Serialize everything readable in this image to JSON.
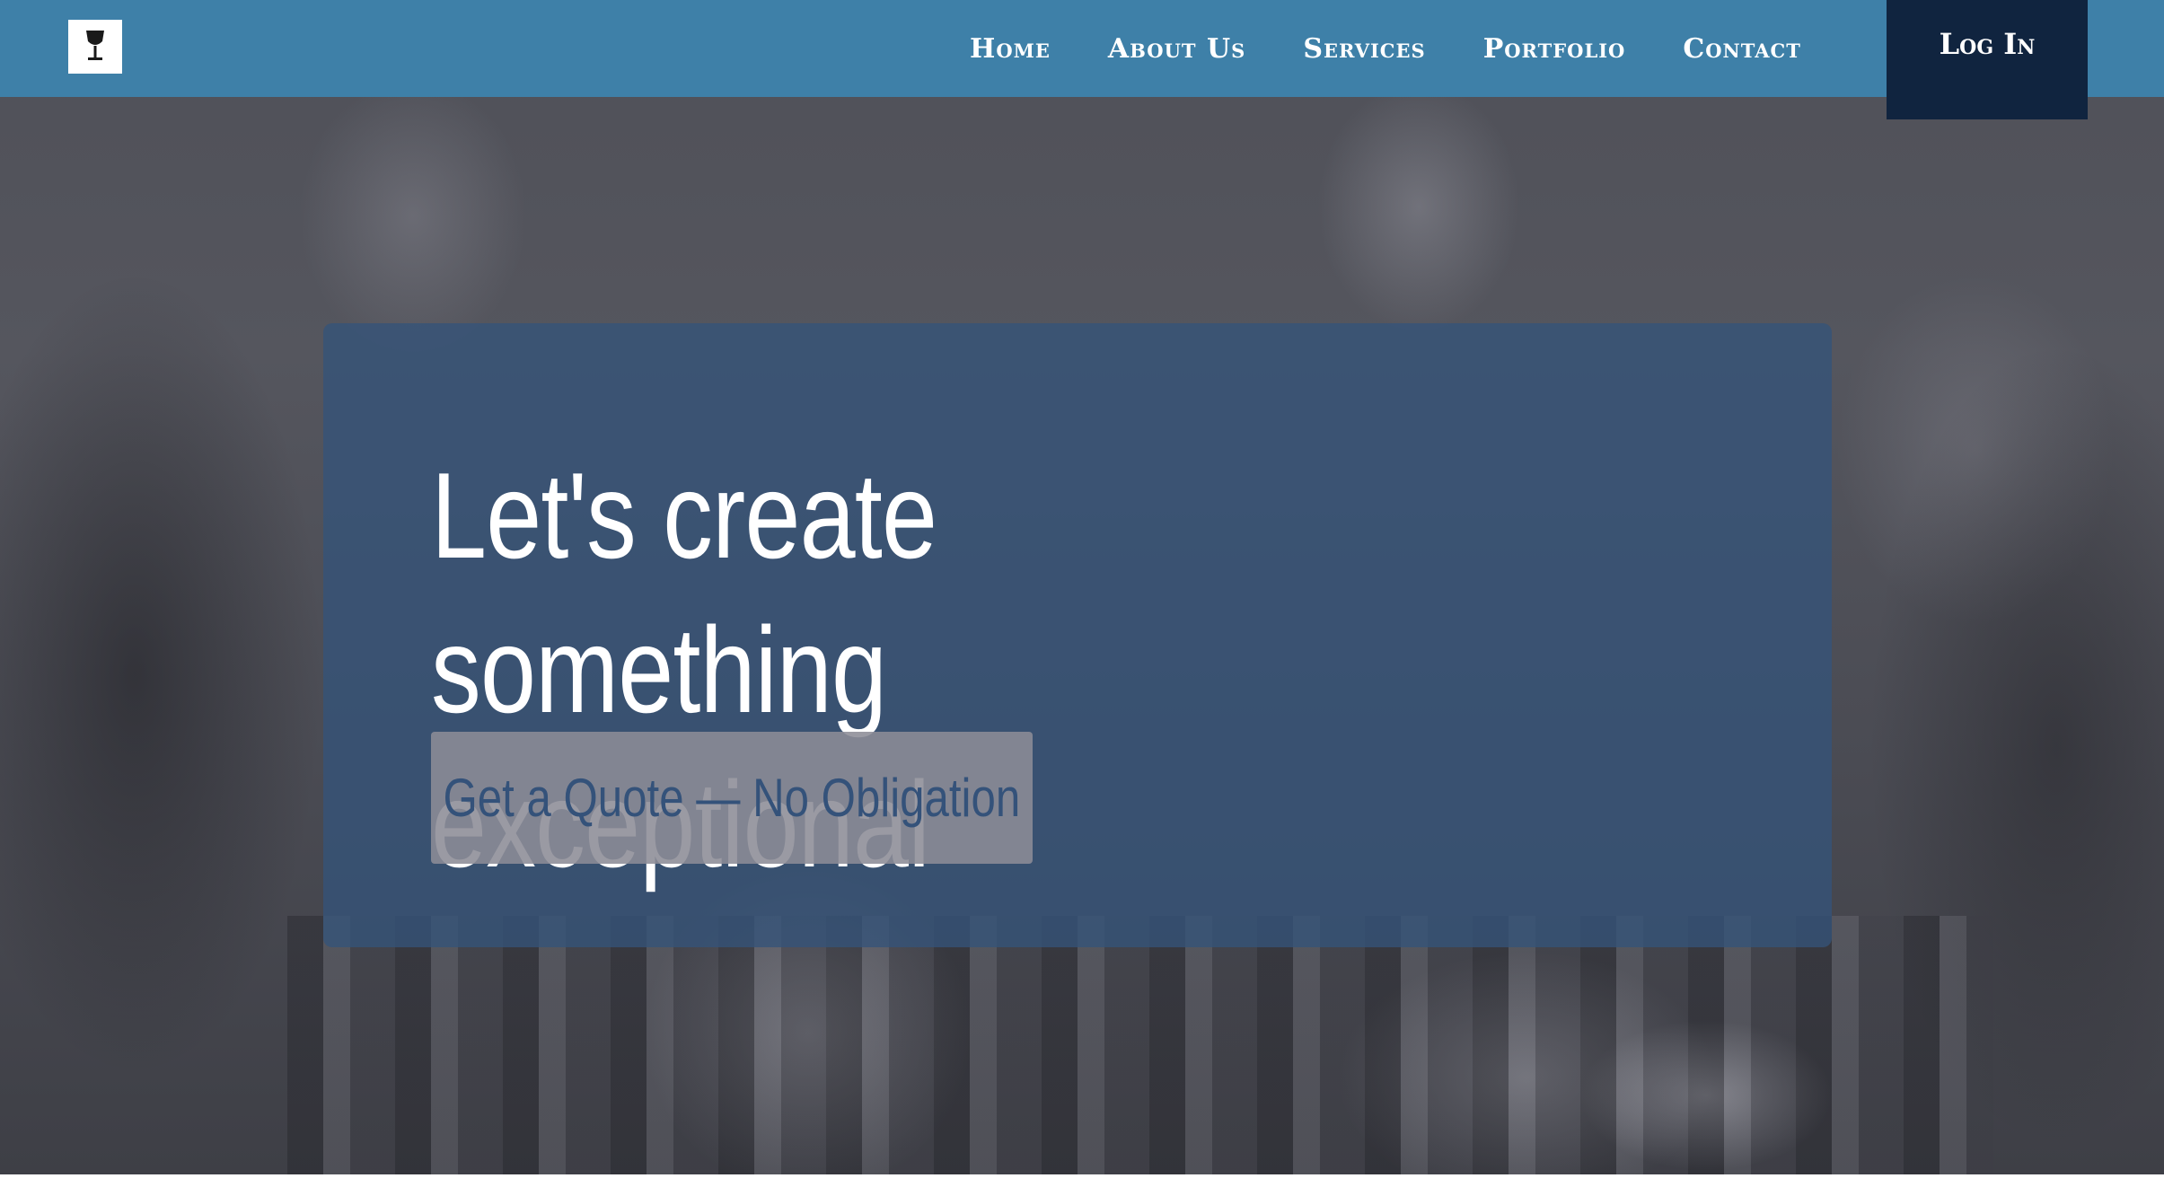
{
  "nav": {
    "logo_icon": "wine-glass-icon",
    "links": [
      "Home",
      "About Us",
      "Services",
      "Portfolio",
      "Contact"
    ],
    "login_label": "Log In"
  },
  "hero": {
    "title_line1": "Let's create something",
    "title_line2": "exceptional",
    "cta_label": "Get a Quote — No Obligation",
    "background": "grayscale photo of a crowded bar"
  },
  "colors": {
    "navbar": "#3e80a8",
    "login_button": "#10243f",
    "hero_card": "#35537a",
    "cta_text": "#34527a"
  }
}
